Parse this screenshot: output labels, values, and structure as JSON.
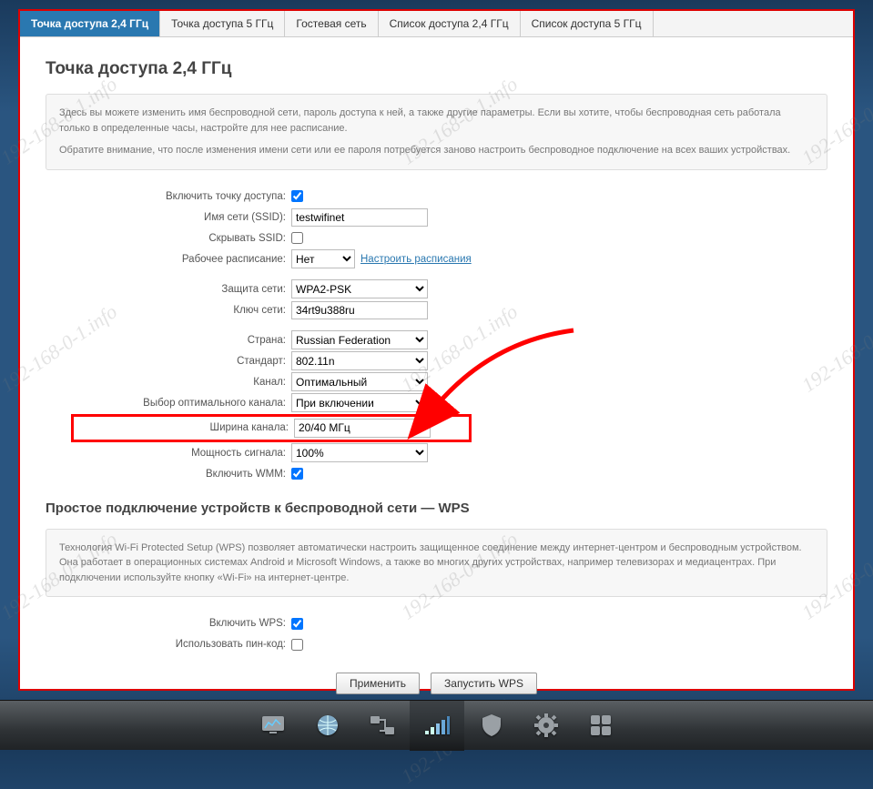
{
  "watermark": "192-168-0-1.info",
  "tabs": [
    {
      "label": "Точка доступа 2,4 ГГц",
      "active": true
    },
    {
      "label": "Точка доступа 5 ГГц"
    },
    {
      "label": "Гостевая сеть"
    },
    {
      "label": "Список доступа 2,4 ГГц"
    },
    {
      "label": "Список доступа 5 ГГц"
    }
  ],
  "page_title": "Точка доступа 2,4 ГГц",
  "intro": {
    "p1": "Здесь вы можете изменить имя беспроводной сети, пароль доступа к ней, а также другие параметры. Если вы хотите, чтобы беспроводная сеть работала только в определенные часы, настройте для нее расписание.",
    "p2": "Обратите внимание, что после изменения имени сети или ее пароля потребуется заново настроить беспроводное подключение на всех ваших устройствах."
  },
  "labels": {
    "enable_ap": "Включить точку доступа:",
    "ssid": "Имя сети (SSID):",
    "hide_ssid": "Скрывать SSID:",
    "schedule": "Рабочее расписание:",
    "schedule_link": "Настроить расписания",
    "security": "Защита сети:",
    "key": "Ключ сети:",
    "country": "Страна:",
    "standard": "Стандарт:",
    "channel": "Канал:",
    "opt_channel": "Выбор оптимального канала:",
    "width": "Ширина канала:",
    "power": "Мощность сигнала:",
    "wmm": "Включить WMM:",
    "wps_enable": "Включить WPS:",
    "wps_pin": "Использовать пин-код:"
  },
  "values": {
    "ssid": "testwifinet",
    "schedule": "Нет",
    "security": "WPA2-PSK",
    "key": "34rt9u388ru",
    "country": "Russian Federation",
    "standard": "802.11n",
    "channel": "Оптимальный",
    "opt_channel": "При включении",
    "width": "20/40 МГц",
    "power": "100%"
  },
  "wps_title": "Простое подключение устройств к беспроводной сети — WPS",
  "wps_text": "Технология Wi-Fi Protected Setup (WPS) позволяет автоматически настроить защищенное соединение между интернет-центром и беспроводным устройством. Она работает в операционных системах Android и Microsoft Windows, а также во многих других устройствах, например телевизорах и медиацентрах. При подключении используйте кнопку «Wi-Fi» на интернет-центре.",
  "buttons": {
    "apply": "Применить",
    "run_wps": "Запустить WPS"
  }
}
